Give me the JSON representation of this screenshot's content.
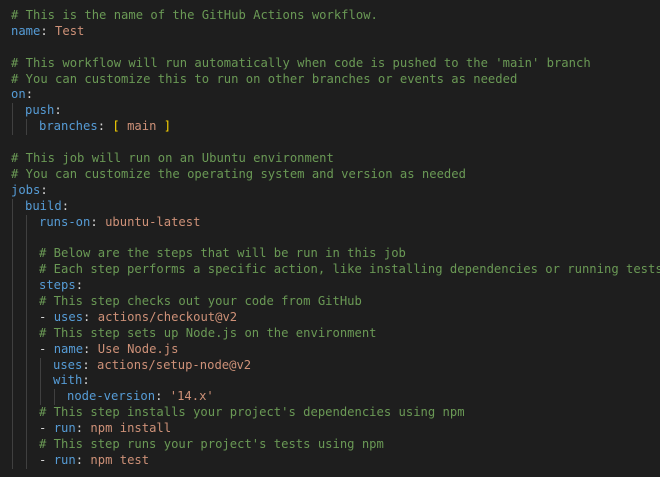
{
  "colors": {
    "background": "#1e1e1e",
    "comment": "#6a9955",
    "key": "#569cd6",
    "string": "#ce9178",
    "punctuation": "#d4d4d4",
    "bracket": "#ffd700",
    "indent_guide": "#404040"
  },
  "lines": [
    {
      "indent": 0,
      "guides": 0,
      "tokens": [
        {
          "t": "# This is the name of the GitHub Actions workflow.",
          "c": "comment"
        }
      ]
    },
    {
      "indent": 0,
      "guides": 0,
      "tokens": [
        {
          "t": "name",
          "c": "key"
        },
        {
          "t": ": ",
          "c": "punct"
        },
        {
          "t": "Test",
          "c": "str"
        }
      ]
    },
    {
      "indent": 0,
      "guides": 0,
      "tokens": []
    },
    {
      "indent": 0,
      "guides": 0,
      "tokens": [
        {
          "t": "# This workflow will run automatically when code is pushed to the 'main' branch",
          "c": "comment"
        }
      ]
    },
    {
      "indent": 0,
      "guides": 0,
      "tokens": [
        {
          "t": "# You can customize this to run on other branches or events as needed",
          "c": "comment"
        }
      ]
    },
    {
      "indent": 0,
      "guides": 0,
      "tokens": [
        {
          "t": "on",
          "c": "key"
        },
        {
          "t": ":",
          "c": "punct"
        }
      ]
    },
    {
      "indent": 1,
      "guides": 1,
      "tokens": [
        {
          "t": "push",
          "c": "key"
        },
        {
          "t": ":",
          "c": "punct"
        }
      ]
    },
    {
      "indent": 2,
      "guides": 2,
      "tokens": [
        {
          "t": "branches",
          "c": "key"
        },
        {
          "t": ": ",
          "c": "punct"
        },
        {
          "t": "[",
          "c": "bracket"
        },
        {
          "t": " main ",
          "c": "str"
        },
        {
          "t": "]",
          "c": "bracket"
        }
      ]
    },
    {
      "indent": 0,
      "guides": 0,
      "tokens": []
    },
    {
      "indent": 0,
      "guides": 0,
      "tokens": [
        {
          "t": "# This job will run on an Ubuntu environment",
          "c": "comment"
        }
      ]
    },
    {
      "indent": 0,
      "guides": 0,
      "tokens": [
        {
          "t": "# You can customize the operating system and version as needed",
          "c": "comment"
        }
      ]
    },
    {
      "indent": 0,
      "guides": 0,
      "tokens": [
        {
          "t": "jobs",
          "c": "key"
        },
        {
          "t": ":",
          "c": "punct"
        }
      ]
    },
    {
      "indent": 1,
      "guides": 1,
      "tokens": [
        {
          "t": "build",
          "c": "key"
        },
        {
          "t": ":",
          "c": "punct"
        }
      ]
    },
    {
      "indent": 2,
      "guides": 2,
      "tokens": [
        {
          "t": "runs-on",
          "c": "key"
        },
        {
          "t": ": ",
          "c": "punct"
        },
        {
          "t": "ubuntu-latest",
          "c": "str"
        }
      ]
    },
    {
      "indent": 2,
      "guides": 2,
      "tokens": []
    },
    {
      "indent": 2,
      "guides": 2,
      "tokens": [
        {
          "t": "# Below are the steps that will be run in this job",
          "c": "comment"
        }
      ]
    },
    {
      "indent": 2,
      "guides": 2,
      "tokens": [
        {
          "t": "# Each step performs a specific action, like installing dependencies or running tests",
          "c": "comment"
        }
      ]
    },
    {
      "indent": 2,
      "guides": 2,
      "tokens": [
        {
          "t": "steps",
          "c": "key"
        },
        {
          "t": ":",
          "c": "punct"
        }
      ]
    },
    {
      "indent": 2,
      "guides": 2,
      "tokens": [
        {
          "t": "# This step checks out your code from GitHub",
          "c": "comment"
        }
      ]
    },
    {
      "indent": 2,
      "guides": 2,
      "tokens": [
        {
          "t": "- ",
          "c": "punct"
        },
        {
          "t": "uses",
          "c": "key"
        },
        {
          "t": ": ",
          "c": "punct"
        },
        {
          "t": "actions/checkout@v2",
          "c": "str"
        }
      ]
    },
    {
      "indent": 2,
      "guides": 2,
      "tokens": [
        {
          "t": "# This step sets up Node.js on the environment",
          "c": "comment"
        }
      ]
    },
    {
      "indent": 2,
      "guides": 2,
      "tokens": [
        {
          "t": "- ",
          "c": "punct"
        },
        {
          "t": "name",
          "c": "key"
        },
        {
          "t": ": ",
          "c": "punct"
        },
        {
          "t": "Use Node.js",
          "c": "str"
        }
      ]
    },
    {
      "indent": 3,
      "guides": 3,
      "tokens": [
        {
          "t": "uses",
          "c": "key"
        },
        {
          "t": ": ",
          "c": "punct"
        },
        {
          "t": "actions/setup-node@v2",
          "c": "str"
        }
      ]
    },
    {
      "indent": 3,
      "guides": 3,
      "tokens": [
        {
          "t": "with",
          "c": "key"
        },
        {
          "t": ":",
          "c": "punct"
        }
      ]
    },
    {
      "indent": 4,
      "guides": 4,
      "tokens": [
        {
          "t": "node-version",
          "c": "key"
        },
        {
          "t": ": ",
          "c": "punct"
        },
        {
          "t": "'14.x'",
          "c": "str"
        }
      ]
    },
    {
      "indent": 2,
      "guides": 2,
      "tokens": [
        {
          "t": "# This step installs your project's dependencies using npm",
          "c": "comment"
        }
      ]
    },
    {
      "indent": 2,
      "guides": 2,
      "tokens": [
        {
          "t": "- ",
          "c": "punct"
        },
        {
          "t": "run",
          "c": "key"
        },
        {
          "t": ": ",
          "c": "punct"
        },
        {
          "t": "npm install",
          "c": "str"
        }
      ]
    },
    {
      "indent": 2,
      "guides": 2,
      "tokens": [
        {
          "t": "# This step runs your project's tests using npm",
          "c": "comment"
        }
      ]
    },
    {
      "indent": 2,
      "guides": 2,
      "tokens": [
        {
          "t": "- ",
          "c": "punct"
        },
        {
          "t": "run",
          "c": "key"
        },
        {
          "t": ": ",
          "c": "punct"
        },
        {
          "t": "npm test",
          "c": "str"
        }
      ]
    }
  ]
}
